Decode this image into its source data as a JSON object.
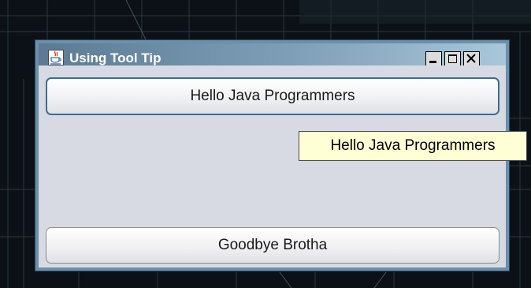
{
  "window": {
    "title": "Using Tool Tip",
    "controls": {
      "minimize_icon": "minimize-icon",
      "maximize_icon": "maximize-icon",
      "close_icon": "close-icon"
    }
  },
  "buttons": {
    "hello_label": "Hello Java Programmers",
    "goodbye_label": "Goodbye Brotha"
  },
  "tooltip": {
    "text": "Hello Java Programmers"
  },
  "colors": {
    "titlebar_start": "#5c7a93",
    "titlebar_end": "#a9c7da",
    "content_bg": "#d7dae3",
    "tooltip_bg": "#ffffd6",
    "focus_border": "#3e6d8d"
  }
}
